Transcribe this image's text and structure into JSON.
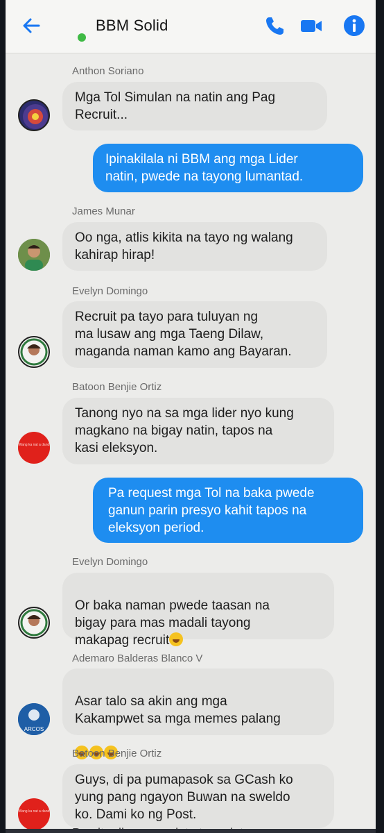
{
  "header": {
    "title": "BBM Solid",
    "icons": {
      "back": "back-arrow-icon",
      "call": "phone-icon",
      "video": "video-camera-icon",
      "info": "info-icon"
    },
    "accent": "#1877f2"
  },
  "messages": [
    {
      "sender": "Anthon Soriano",
      "text": "Mga Tol Simulan na natin ang Pag\nRecruit..."
    },
    {
      "text": "Ipinakilala ni BBM ang mga Lider\nnatin, pwede na tayong lumantad."
    },
    {
      "sender": "James Munar",
      "text": "Oo nga, atlis kikita na tayo ng walang\nkahirap hirap!"
    },
    {
      "sender": "Evelyn Domingo",
      "text": "Recruit pa tayo para tuluyan ng\nma lusaw ang mga Taeng Dilaw,\nmaganda naman kamo ang Bayaran."
    },
    {
      "sender": "Batoon Benjie Ortiz",
      "text": "Tanong nyo na sa mga lider nyo kung\nmagkano na bigay natin, tapos na\nkasi eleksyon.",
      "avatar_text": "Wang ka nat a dand"
    },
    {
      "text": "Pa request mga Tol na baka pwede\nganun parin presyo kahit tapos na\neleksyon period."
    },
    {
      "sender": "Evelyn Domingo",
      "text": "Or baka naman pwede taasan na\nbigay para mas madali tayong\nmakapag recruit"
    },
    {
      "sender": "Ademaro Balderas Blanco V",
      "text": "Asar talo sa akin ang mga\nKakampwet sa mga memes palang",
      "avatar_text": "ARCOS"
    },
    {
      "sender": "Batoon Benjie Ortiz",
      "text": "Guys, di pa pumapasok sa GCash ko\nyung pang ngayon Buwan na sweldo\nko. Dami ko ng Post.",
      "avatar_text": "Wang ka nat a dand"
    }
  ],
  "cut_off_text": "Pag ito di sumasadat at pasdat"
}
